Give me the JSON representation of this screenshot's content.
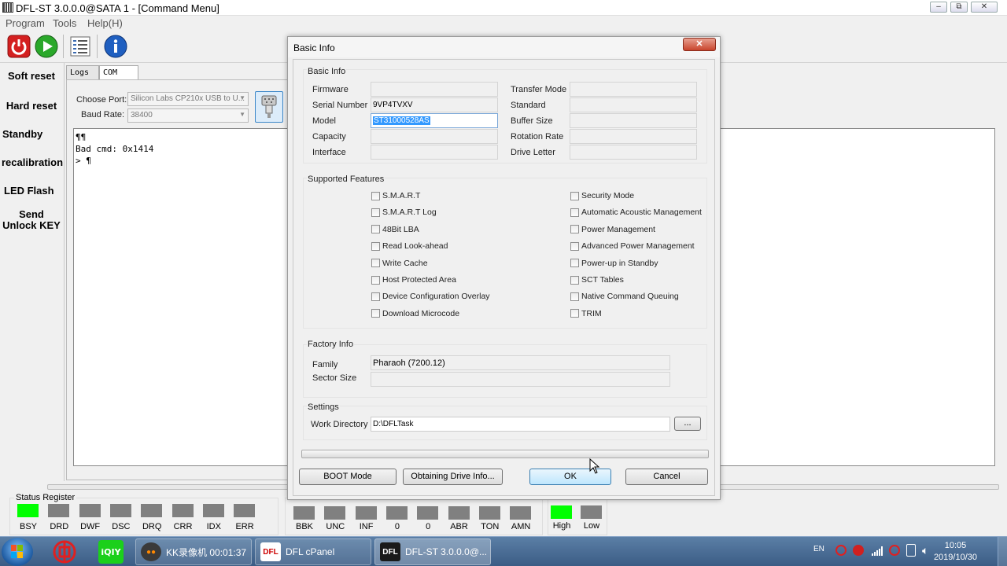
{
  "window": {
    "title": "DFL-ST 3.0.0.0@SATA 1 - [Command Menu]",
    "min": "▭",
    "restore": "⧉",
    "close": "✕"
  },
  "menu": [
    "Program",
    "Tools",
    "Help(H)"
  ],
  "toolbar": {
    "icons": [
      "power-icon",
      "play-icon",
      "list-icon",
      "info-icon"
    ]
  },
  "sidebar": {
    "items": [
      "Soft reset",
      "Hard reset",
      "Standby",
      "recalibration",
      "LED Flash",
      "Send\nUnlock KEY"
    ]
  },
  "tabs": [
    "Logs",
    "COM"
  ],
  "com": {
    "port_label": "Choose Port:",
    "port_value": "Silicon Labs CP210x USB to U...",
    "baud_label": "Baud Rate:",
    "baud_value": "38400"
  },
  "console": {
    "lines": [
      "¶¶",
      "Bad cmd: 0x1414",
      "> ¶"
    ]
  },
  "status": {
    "register_label": "Status Register",
    "leds1": [
      {
        "label": "BSY",
        "on": true
      },
      {
        "label": "DRD",
        "on": false
      },
      {
        "label": "DWF",
        "on": false
      },
      {
        "label": "DSC",
        "on": false
      },
      {
        "label": "DRQ",
        "on": false
      },
      {
        "label": "CRR",
        "on": false
      },
      {
        "label": "IDX",
        "on": false
      },
      {
        "label": "ERR",
        "on": false
      }
    ],
    "leds2": [
      {
        "label": "BBK",
        "on": false
      },
      {
        "label": "UNC",
        "on": false
      },
      {
        "label": "INF",
        "on": false
      },
      {
        "label": "0",
        "on": false
      },
      {
        "label": "0",
        "on": false
      },
      {
        "label": "ABR",
        "on": false
      },
      {
        "label": "TON",
        "on": false
      },
      {
        "label": "AMN",
        "on": false
      }
    ],
    "leds3": [
      {
        "label": "High",
        "on": true
      },
      {
        "label": "Low",
        "on": false
      }
    ]
  },
  "dialog": {
    "title": "Basic Info",
    "close": "✕",
    "basic_info": {
      "group": "Basic Info",
      "firmware_label": "Firmware",
      "firmware_value": "",
      "serial_label": "Serial Number",
      "serial_value": "9VP4TVXV",
      "model_label": "Model",
      "model_value": "ST31000528AS",
      "capacity_label": "Capacity",
      "capacity_value": "",
      "interface_label": "Interface",
      "interface_value": "",
      "transfer_label": "Transfer Mode",
      "transfer_value": "",
      "standard_label": "Standard",
      "standard_value": "",
      "buffer_label": "Buffer Size",
      "buffer_value": "",
      "rotation_label": "Rotation Rate",
      "rotation_value": "",
      "drive_letter_label": "Drive Letter",
      "drive_letter_value": ""
    },
    "features": {
      "group": "Supported Features",
      "left": [
        "S.M.A.R.T",
        "S.M.A.R.T Log",
        "48Bit LBA",
        "Read Look-ahead",
        "Write Cache",
        "Host Protected Area",
        "Device Configuration Overlay",
        "Download Microcode"
      ],
      "right": [
        "Security Mode",
        "Automatic Acoustic Management",
        "Power Management",
        "Advanced Power Management",
        "Power-up in Standby",
        "SCT Tables",
        "Native Command Queuing",
        "TRIM"
      ]
    },
    "factory": {
      "group": "Factory Info",
      "family_label": "Family",
      "family_value": "Pharaoh (7200.12)",
      "sector_label": "Sector Size",
      "sector_value": ""
    },
    "settings": {
      "group": "Settings",
      "workdir_label": "Work Directory",
      "workdir_value": "D:\\DFLTask",
      "browse": "..."
    },
    "buttons": {
      "boot": "BOOT Mode",
      "obtain": "Obtaining Drive Info...",
      "ok": "OK",
      "cancel": "Cancel"
    }
  },
  "taskbar": {
    "apps": [
      {
        "label": "KK录像机 00:01:37"
      },
      {
        "label": "DFL cPanel"
      },
      {
        "label": "DFL-ST 3.0.0.0@..."
      }
    ],
    "lang": "EN",
    "time": "10:05",
    "date": "2019/10/30"
  }
}
